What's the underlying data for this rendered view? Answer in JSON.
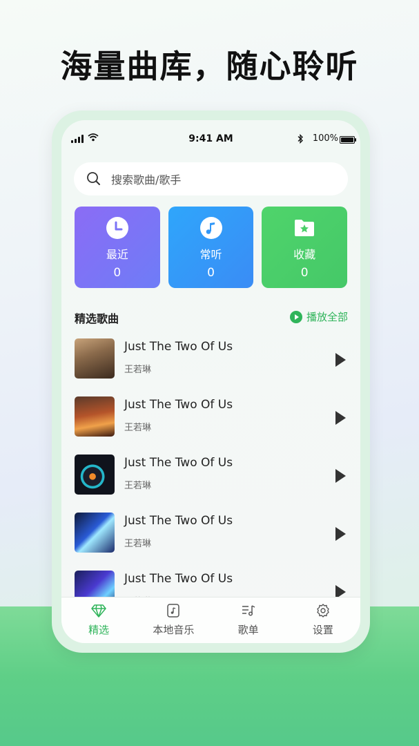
{
  "headline": "海量曲库，随心聆听",
  "status_bar": {
    "time": "9:41 AM",
    "battery": "100%"
  },
  "search": {
    "placeholder": "搜索歌曲/歌手",
    "icon": "search-icon"
  },
  "tiles": [
    {
      "label": "最近",
      "count": "0",
      "icon": "clock-icon",
      "color": "#7b73f6"
    },
    {
      "label": "常听",
      "count": "0",
      "icon": "music-note-icon",
      "color": "#3298f8"
    },
    {
      "label": "收藏",
      "count": "0",
      "icon": "folder-star-icon",
      "color": "#4bcf69"
    }
  ],
  "section": {
    "title": "精选歌曲",
    "play_all": "播放全部"
  },
  "songs": [
    {
      "title": "Just The Two Of Us",
      "artist": "王若琳"
    },
    {
      "title": "Just The Two Of Us",
      "artist": "王若琳"
    },
    {
      "title": "Just The Two Of Us",
      "artist": "王若琳"
    },
    {
      "title": "Just The Two Of Us",
      "artist": "王若琳"
    },
    {
      "title": "Just The Two Of Us",
      "artist": "王若琳"
    }
  ],
  "tabs": [
    {
      "label": "精选",
      "icon": "diamond-icon",
      "active": true
    },
    {
      "label": "本地音乐",
      "icon": "local-music-icon",
      "active": false
    },
    {
      "label": "歌单",
      "icon": "playlist-icon",
      "active": false
    },
    {
      "label": "设置",
      "icon": "gear-icon",
      "active": false
    }
  ],
  "colors": {
    "accent": "#2fb45a",
    "bottom_band": "#5fcf87"
  }
}
